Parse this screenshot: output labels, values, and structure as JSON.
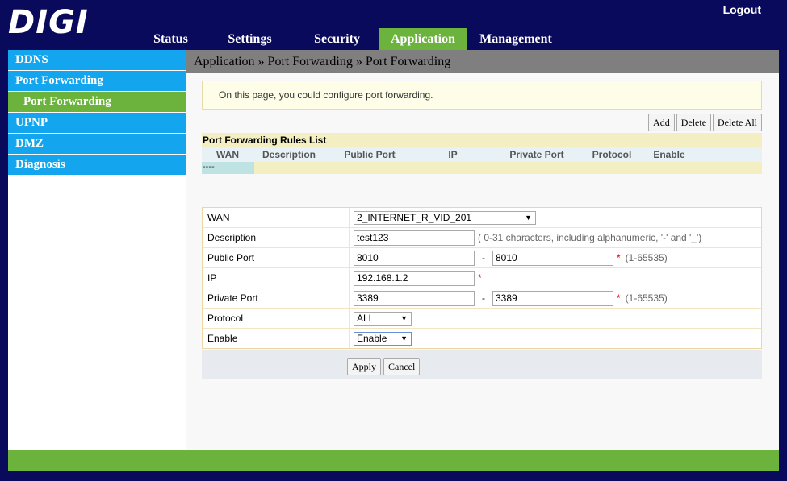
{
  "header": {
    "logo": "DIGI",
    "logout": "Logout",
    "tabs": [
      {
        "label": "Status",
        "active": false
      },
      {
        "label": "Settings",
        "active": false
      },
      {
        "label": "Security",
        "active": false
      },
      {
        "label": "Application",
        "active": true
      },
      {
        "label": "Management",
        "active": false
      }
    ]
  },
  "sidebar": {
    "items": [
      {
        "label": "DDNS"
      },
      {
        "label": "Port Forwarding"
      },
      {
        "label": "Port Forwarding",
        "sub": true,
        "active": true
      },
      {
        "label": "UPNP"
      },
      {
        "label": "DMZ"
      },
      {
        "label": "Diagnosis"
      }
    ]
  },
  "breadcrumb": "Application » Port Forwarding » Port Forwarding",
  "info": "On this page, you could configure port forwarding.",
  "buttons": {
    "add": "Add",
    "delete": "Delete",
    "delete_all": "Delete All"
  },
  "rules": {
    "title": "Port Forwarding Rules List",
    "columns": [
      "WAN",
      "Description",
      "Public Port",
      "IP",
      "Private Port",
      "Protocol",
      "Enable"
    ],
    "empty_row": "----"
  },
  "form": {
    "wan": {
      "label": "WAN",
      "value": "2_INTERNET_R_VID_201"
    },
    "description": {
      "label": "Description",
      "value": "test123",
      "hint": "( 0-31 characters, including alphanumeric, '-' and '_')"
    },
    "public_port": {
      "label": "Public Port",
      "from": "8010",
      "to": "8010",
      "range": "(1-65535)"
    },
    "ip": {
      "label": "IP",
      "value": "192.168.1.2"
    },
    "private_port": {
      "label": "Private Port",
      "from": "3389",
      "to": "3389",
      "range": "(1-65535)"
    },
    "protocol": {
      "label": "Protocol",
      "value": "ALL"
    },
    "enable": {
      "label": "Enable",
      "value": "Enable"
    },
    "required_mark": "*",
    "dash": "-"
  },
  "actions": {
    "apply": "Apply",
    "cancel": "Cancel"
  },
  "colors": {
    "navy": "#0a0a5c",
    "green": "#6cb33e",
    "blue": "#13a6ef"
  }
}
